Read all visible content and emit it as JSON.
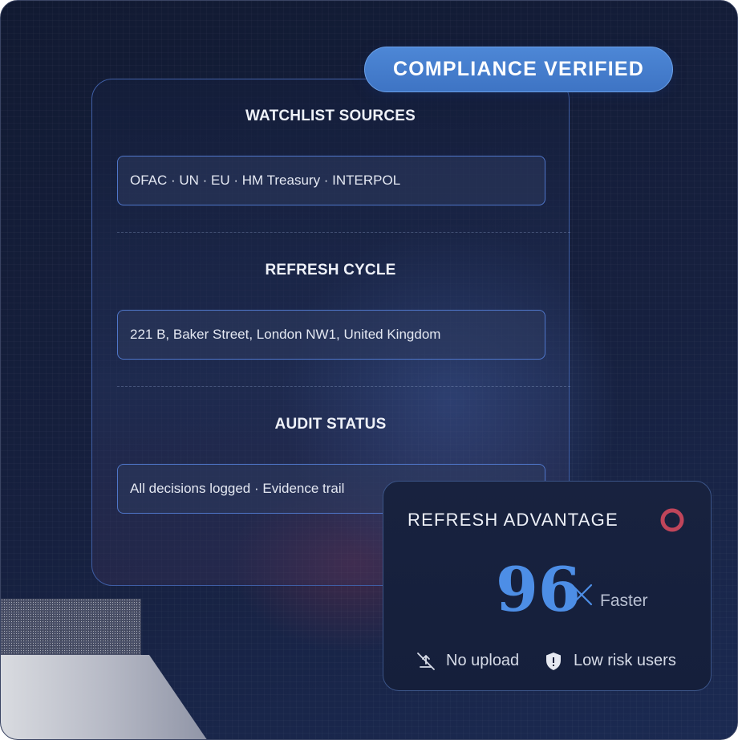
{
  "badge": {
    "label": "COMPLIANCE VERIFIED"
  },
  "sections": [
    {
      "title": "WATCHLIST SOURCES",
      "value": "OFAC · UN · EU · HM Treasury · INTERPOL"
    },
    {
      "title": "REFRESH CYCLE",
      "value": "221 B, Baker Street, London NW1, United Kingdom"
    },
    {
      "title": "AUDIT STATUS",
      "value": "All decisions logged · Evidence trail"
    }
  ],
  "advantage": {
    "title": "REFRESH ADVANTAGE",
    "multiplier": "96",
    "multiplier_symbol": "×",
    "unit": "Faster",
    "features": [
      {
        "icon": "no-upload-icon",
        "label": "No upload"
      },
      {
        "icon": "shield-icon",
        "label": "Low risk users"
      }
    ]
  },
  "colors": {
    "accent": "#4d8ee6",
    "badge": "#4579c9",
    "ring": "#c0455a"
  }
}
